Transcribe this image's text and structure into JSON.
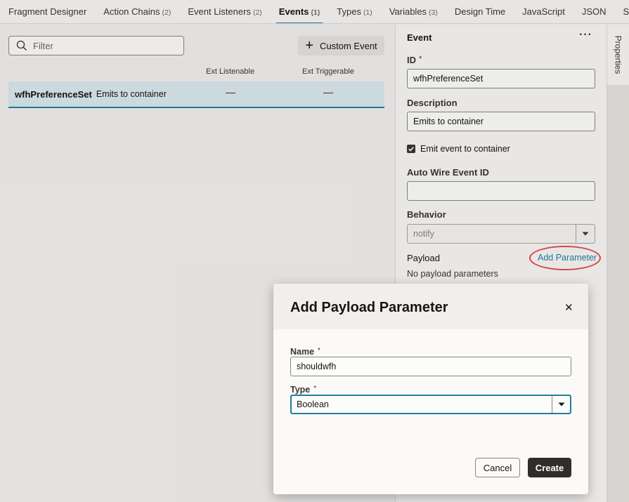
{
  "tabs": [
    {
      "label": "Fragment Designer",
      "count": ""
    },
    {
      "label": "Action Chains",
      "count": "(2)"
    },
    {
      "label": "Event Listeners",
      "count": "(2)"
    },
    {
      "label": "Events",
      "count": "(1)",
      "active": true
    },
    {
      "label": "Types",
      "count": "(1)"
    },
    {
      "label": "Variables",
      "count": "(3)"
    },
    {
      "label": "Design Time",
      "count": ""
    },
    {
      "label": "JavaScript",
      "count": ""
    },
    {
      "label": "JSON",
      "count": ""
    },
    {
      "label": "Settings",
      "count": ""
    }
  ],
  "events_list": {
    "filter_placeholder": "Filter",
    "custom_event_label": "Custom Event",
    "columns": [
      "Ext Listenable",
      "Ext Triggerable"
    ],
    "rows": [
      {
        "name": "wfhPreferenceSet",
        "description": "Emits to container",
        "ext_listenable": "—",
        "ext_triggerable": "—"
      }
    ]
  },
  "properties": {
    "title": "Event",
    "more_icon": "more-horizontal-icon",
    "id_label": "ID",
    "id_required": "*",
    "id_value": "wfhPreferenceSet",
    "description_label": "Description",
    "description_value": "Emits to container",
    "emit_checkbox_label": "Emit event to container",
    "emit_checked": true,
    "auto_wire_label": "Auto Wire Event ID",
    "auto_wire_value": "",
    "behavior_label": "Behavior",
    "behavior_value": "notify",
    "payload_label": "Payload",
    "add_parameter_label": "Add Parameter",
    "no_payload_text": "No payload parameters",
    "side_tab_label": "Properties"
  },
  "dialog": {
    "title": "Add Payload Parameter",
    "name_label": "Name",
    "name_required": "*",
    "name_value": "shouldwfh",
    "type_label": "Type",
    "type_required": "*",
    "type_value": "Boolean",
    "cancel_label": "Cancel",
    "create_label": "Create"
  },
  "colors": {
    "accent": "#227e9e",
    "highlight_ring": "#e8484a",
    "primary_button": "#312d2a"
  }
}
